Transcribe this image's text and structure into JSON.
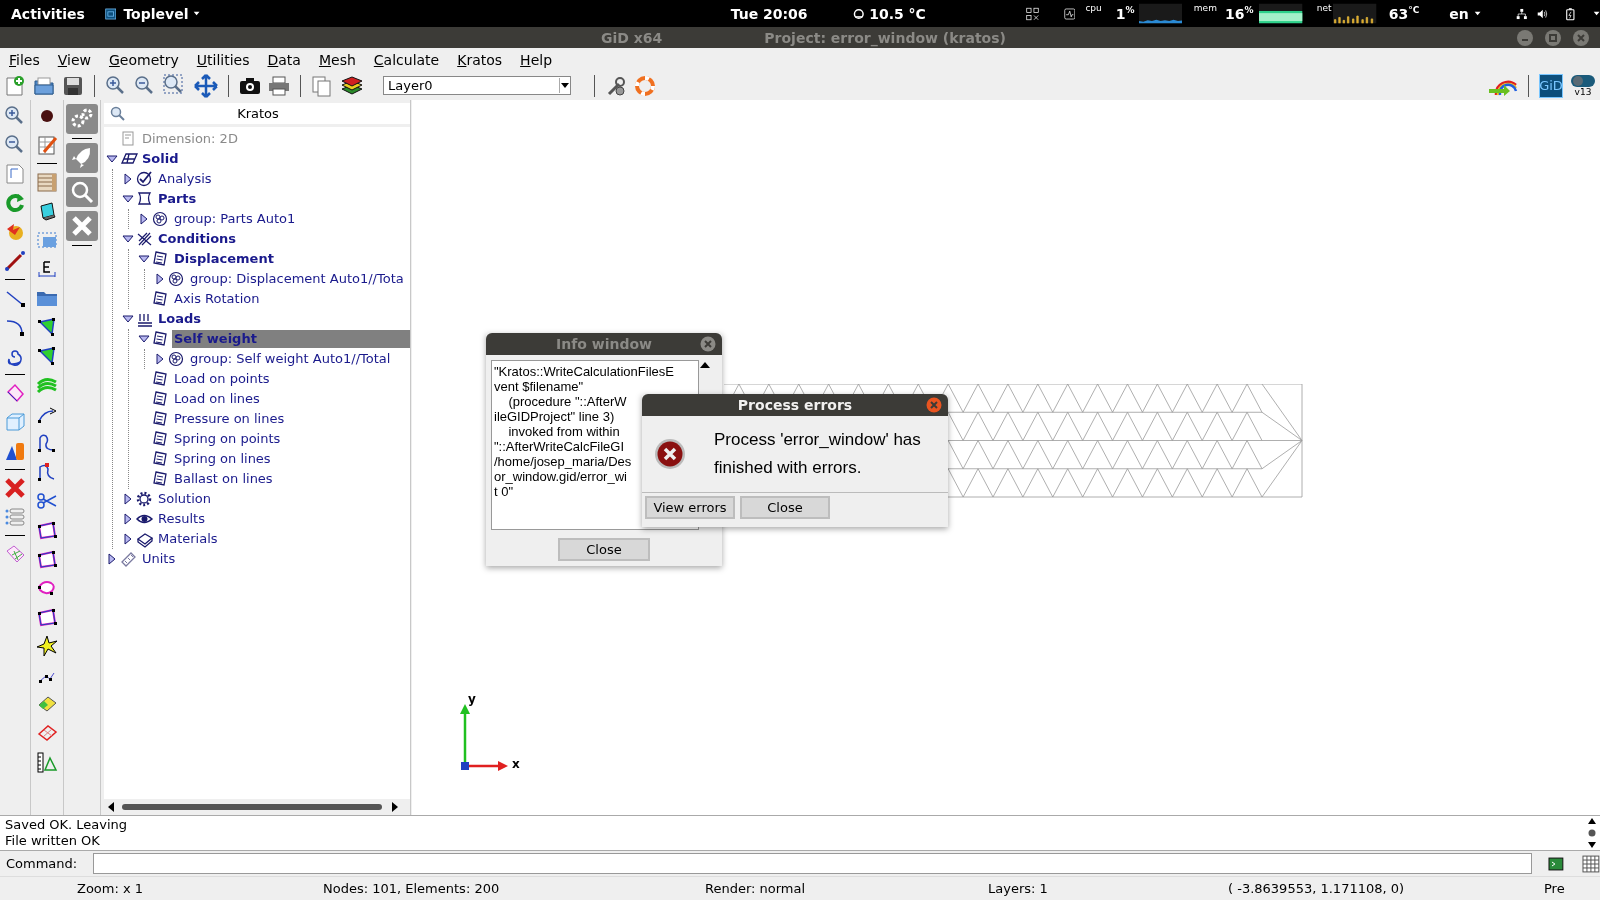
{
  "top_bar": {
    "activities": "Activities",
    "app_menu": "Toplevel",
    "clock": "Tue 20:06",
    "weather": "10.5 °C",
    "cpu_label": "cpu",
    "cpu_value": "1$^{%}$",
    "mem_label": "mem",
    "mem_value": "16$^{%}$",
    "net_label": "net",
    "temperature": "63$^{°C}$",
    "language": "en"
  },
  "window": {
    "app": "GiD x64",
    "title": "Project: error_window (kratos)"
  },
  "menu": [
    "Files",
    "View",
    "Geometry",
    "Utilities",
    "Data",
    "Mesh",
    "Calculate",
    "Kratos",
    "Help"
  ],
  "toolbar": {
    "layer": "Layer0",
    "logo": "GiD",
    "version": "v13"
  },
  "tree": {
    "title": "Kratos",
    "nodes": [
      {
        "label": "Dimension: 2D",
        "kind": "setting",
        "expandable": false,
        "expanded": false,
        "selected": false,
        "disabled": true
      },
      {
        "label": "Solid",
        "kind": "container",
        "expandable": true,
        "expanded": true,
        "selected": false,
        "disabled": false,
        "children": [
          {
            "label": "Analysis",
            "kind": "checklist",
            "expandable": true,
            "expanded": false,
            "selected": false,
            "disabled": false
          },
          {
            "label": "Parts",
            "kind": "parts",
            "expandable": true,
            "expanded": true,
            "selected": false,
            "disabled": false,
            "children": [
              {
                "label": "group: Parts Auto1",
                "kind": "group",
                "expandable": true,
                "expanded": false,
                "selected": false,
                "disabled": false
              }
            ]
          },
          {
            "label": "Conditions",
            "kind": "conditions",
            "expandable": true,
            "expanded": true,
            "selected": false,
            "disabled": false,
            "children": [
              {
                "label": "Displacement",
                "kind": "condition",
                "expandable": true,
                "expanded": true,
                "selected": false,
                "disabled": false,
                "children": [
                  {
                    "label": "group: Displacement Auto1//Tota",
                    "kind": "group",
                    "expandable": true,
                    "expanded": false,
                    "selected": false,
                    "disabled": false
                  }
                ]
              },
              {
                "label": "Axis Rotation",
                "kind": "condition",
                "expandable": false,
                "expanded": false,
                "selected": false,
                "disabled": false
              }
            ]
          },
          {
            "label": "Loads",
            "kind": "loads",
            "expandable": true,
            "expanded": true,
            "selected": false,
            "disabled": false,
            "children": [
              {
                "label": "Self weight",
                "kind": "condition",
                "expandable": true,
                "expanded": true,
                "selected": true,
                "disabled": false,
                "children": [
                  {
                    "label": "group: Self weight Auto1//Total",
                    "kind": "group",
                    "expandable": true,
                    "expanded": false,
                    "selected": false,
                    "disabled": false
                  }
                ]
              },
              {
                "label": "Load on points",
                "kind": "condition",
                "expandable": false,
                "expanded": false,
                "selected": false,
                "disabled": false
              },
              {
                "label": "Load on lines",
                "kind": "condition",
                "expandable": false,
                "expanded": false,
                "selected": false,
                "disabled": false
              },
              {
                "label": "Pressure on lines",
                "kind": "condition",
                "expandable": false,
                "expanded": false,
                "selected": false,
                "disabled": false
              },
              {
                "label": "Spring on points",
                "kind": "condition",
                "expandable": false,
                "expanded": false,
                "selected": false,
                "disabled": false
              },
              {
                "label": "Spring on lines",
                "kind": "condition",
                "expandable": false,
                "expanded": false,
                "selected": false,
                "disabled": false
              },
              {
                "label": "Ballast on lines",
                "kind": "condition",
                "expandable": false,
                "expanded": false,
                "selected": false,
                "disabled": false
              }
            ]
          },
          {
            "label": "Solution",
            "kind": "solution",
            "expandable": true,
            "expanded": false,
            "selected": false,
            "disabled": false
          },
          {
            "label": "Results",
            "kind": "results",
            "expandable": true,
            "expanded": false,
            "selected": false,
            "disabled": false
          },
          {
            "label": "Materials",
            "kind": "materials",
            "expandable": true,
            "expanded": false,
            "selected": false,
            "disabled": false
          }
        ]
      },
      {
        "label": "Units",
        "kind": "units",
        "expandable": true,
        "expanded": false,
        "selected": false,
        "disabled": false
      }
    ]
  },
  "info_window": {
    "title": "Info window",
    "lines": [
      "\"Kratos::WriteCalculationFilesE",
      "vent $filename\"",
      "    (procedure \"::AfterW",
      "ileGIDProject\" line 3)",
      "    invoked from within",
      "\"::AfterWriteCalcFileGI",
      "/home/josep_maria/Des",
      "or_window.gid/error_wi",
      "t 0\""
    ],
    "close": "Close"
  },
  "process_errors": {
    "title": "Process errors",
    "message": "Process 'error_window' has finished with errors.",
    "buttons": [
      "View errors",
      "Close"
    ]
  },
  "axes": {
    "x": "x",
    "y": "y"
  },
  "log": [
    "Saved OK. Leaving",
    "File written OK"
  ],
  "command": {
    "label": "Command:"
  },
  "status_bar": [
    "Zoom: x 1",
    "Nodes: 101, Elements: 200",
    "Render: normal",
    "Layers: 1",
    "( -3.8639553,  1.171108,  0)",
    "Pre"
  ]
}
